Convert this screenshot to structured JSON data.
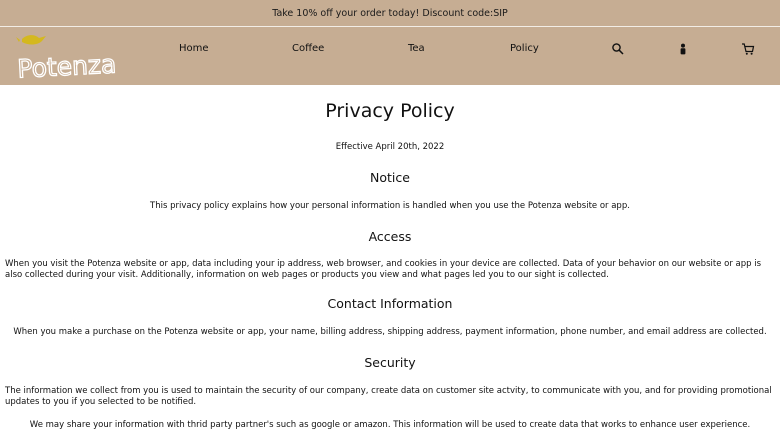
{
  "promo": {
    "text": "Take 10% off your order today! Discount code:SIP"
  },
  "header": {
    "logo_text": "Potenza",
    "nav": [
      {
        "label": "Home"
      },
      {
        "label": "Coffee"
      },
      {
        "label": "Tea"
      },
      {
        "label": "Policy"
      }
    ],
    "icons": [
      "search-icon",
      "account-icon",
      "cart-icon"
    ]
  },
  "colors": {
    "header_bg": "#c6ad93",
    "logo_accent": "#d4b81f",
    "logo_text": "#ffffff"
  },
  "page": {
    "title": "Privacy Policy",
    "effective": "Effective April 20th, 2022",
    "sections": [
      {
        "heading": "Notice",
        "body": "This privacy policy explains how your personal information is handled when you use the Potenza website or app."
      },
      {
        "heading": "Access",
        "body": "When you visit the Potenza website or app, data including your ip address, web browser, and cookies in your device are collected. Data of your behavior on our website or app is also collected during your visit. Additionally, information on web pages or products you view and what pages led you to our sight is collected."
      },
      {
        "heading": "Contact Information",
        "body": "When you make a purchase on the Potenza website or app, your name, billing address, shipping address, payment information, phone number, and email address are collected."
      },
      {
        "heading": "Security",
        "body": "The information we collect from you is used to maintain the security of our company, create data on customer site actvity, to communicate with you, and for providing promotional updates to you if you selected to be notified."
      },
      {
        "heading": "",
        "body": "We may share your information with thrid party partner's such as google or amazon. This information will be used to create data that works to enhance user experience."
      }
    ]
  }
}
